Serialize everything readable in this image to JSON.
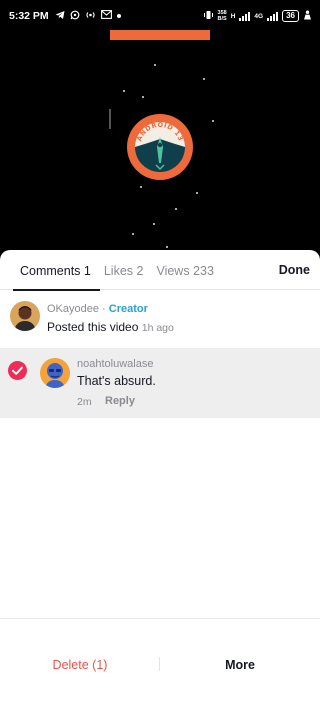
{
  "status_bar": {
    "time": "5:32 PM",
    "speed_value": "358",
    "speed_unit": "B/S",
    "network_1": "H",
    "network_2": "4G",
    "battery": "36"
  },
  "video": {
    "logo_text": "ANDROID 13",
    "bar_color": "#ee6a3b"
  },
  "tabs": {
    "comments": "Comments 1",
    "likes": "Likes 2",
    "views": "Views 233",
    "done": "Done"
  },
  "creator_post": {
    "author": "OKayodee",
    "separator": " · ",
    "badge": "Creator",
    "text": "Posted this video",
    "time": "1h ago"
  },
  "comment": {
    "username": "noahtoluwalase",
    "text": "That's absurd.",
    "time": "2m",
    "reply_label": "Reply",
    "selected": true
  },
  "actions": {
    "delete_label": "Delete (1)",
    "more_label": "More"
  },
  "colors": {
    "accent_red": "#f02c56",
    "delete_text": "#f0524a",
    "creator_badge": "#2aa0d8"
  }
}
